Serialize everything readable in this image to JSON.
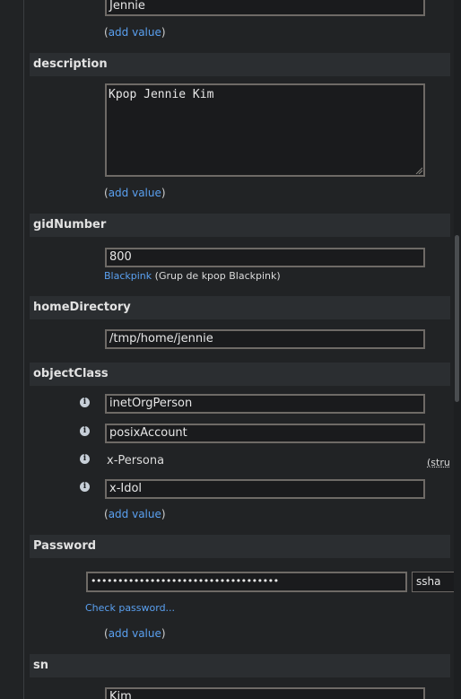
{
  "fields": {
    "givenname": {
      "value": "Jennie",
      "add_value": "add value"
    },
    "description": {
      "label": "description",
      "value": "Kpop Jennie Kim",
      "add_value": "add value"
    },
    "gidnumber": {
      "label": "gidNumber",
      "value": "800",
      "group_link": "Blackpink",
      "group_desc": "(Grup de kpop Blackpink)"
    },
    "homedirectory": {
      "label": "homeDirectory",
      "value": "/tmp/home/jennie"
    },
    "objectclass": {
      "label": "objectClass",
      "values": [
        "inetOrgPerson",
        "posixAccount",
        "x-Persona",
        "x-Idol"
      ],
      "structural_hint": "(stru",
      "add_value": "add value"
    },
    "password": {
      "label": "Password",
      "value": "•••••••••••••••••••••••••••••••••••",
      "hash": "ssha",
      "check_link": "Check password...",
      "add_value": "add value"
    },
    "sn": {
      "label": "sn",
      "value": "Kim"
    }
  },
  "icons": {
    "info": "info-icon"
  },
  "colors": {
    "link": "#5aa0f0",
    "background": "#212325",
    "header": "#2b2e31"
  }
}
